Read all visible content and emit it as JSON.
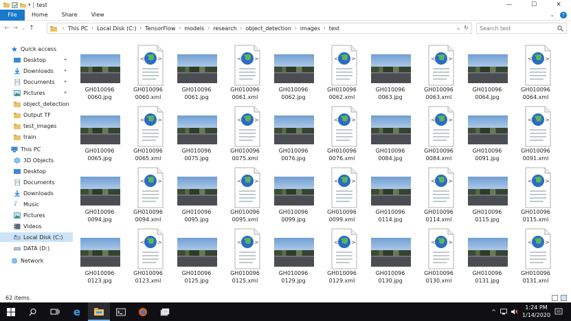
{
  "window": {
    "title": "test",
    "min": "—",
    "max": "☐",
    "close": "✕"
  },
  "ribbon": {
    "file_tab": "File",
    "tabs": [
      "Home",
      "Share",
      "View"
    ],
    "help": "?"
  },
  "address": {
    "crumbs": [
      "This PC",
      "Local Disk (C:)",
      "TensorFlow",
      "models",
      "research",
      "object_detection",
      "images",
      "test"
    ],
    "search_placeholder": "Search test"
  },
  "sidebar": {
    "quick_access": "Quick access",
    "quick_items": [
      {
        "label": "Desktop",
        "pinned": true
      },
      {
        "label": "Downloads",
        "pinned": true
      },
      {
        "label": "Documents",
        "pinned": true
      },
      {
        "label": "Pictures",
        "pinned": true
      },
      {
        "label": "object_detection",
        "pinned": false
      },
      {
        "label": "Output TF",
        "pinned": false
      },
      {
        "label": "test_images",
        "pinned": false
      },
      {
        "label": "train",
        "pinned": false
      }
    ],
    "this_pc": "This PC",
    "pc_items": [
      "3D Objects",
      "Desktop",
      "Documents",
      "Downloads",
      "Music",
      "Pictures",
      "Videos",
      "Local Disk (C:)",
      "DATA (D:)"
    ],
    "network": "Network"
  },
  "files": [
    {
      "line1": "GH010096",
      "line2": "0060.jpg",
      "type": "jpg"
    },
    {
      "line1": "GH010096",
      "line2": "0060.xml",
      "type": "xml"
    },
    {
      "line1": "GH010096",
      "line2": "0061.jpg",
      "type": "jpg"
    },
    {
      "line1": "GH010096",
      "line2": "0061.xml",
      "type": "xml"
    },
    {
      "line1": "GH010096",
      "line2": "0062.jpg",
      "type": "jpg"
    },
    {
      "line1": "GH010096",
      "line2": "0062.xml",
      "type": "xml"
    },
    {
      "line1": "GH010096",
      "line2": "0063.jpg",
      "type": "jpg"
    },
    {
      "line1": "GH010096",
      "line2": "0063.xml",
      "type": "xml"
    },
    {
      "line1": "GH010096",
      "line2": "0064.jpg",
      "type": "jpg"
    },
    {
      "line1": "GH010096",
      "line2": "0064.xml",
      "type": "xml"
    },
    {
      "line1": "GH010096",
      "line2": "0065.jpg",
      "type": "jpg"
    },
    {
      "line1": "GH010096",
      "line2": "0065.xml",
      "type": "xml"
    },
    {
      "line1": "GH010096",
      "line2": "0075.jpg",
      "type": "jpg"
    },
    {
      "line1": "GH010096",
      "line2": "0075.xml",
      "type": "xml"
    },
    {
      "line1": "GH010096",
      "line2": "0076.jpg",
      "type": "jpg"
    },
    {
      "line1": "GH010096",
      "line2": "0076.xml",
      "type": "xml"
    },
    {
      "line1": "GH010096",
      "line2": "0084.jpg",
      "type": "jpg"
    },
    {
      "line1": "GH010096",
      "line2": "0084.xml",
      "type": "xml"
    },
    {
      "line1": "GH010096",
      "line2": "0091.jpg",
      "type": "jpg"
    },
    {
      "line1": "GH010096",
      "line2": "0091.xml",
      "type": "xml"
    },
    {
      "line1": "GH010096",
      "line2": "0094.jpg",
      "type": "jpg"
    },
    {
      "line1": "GH010096",
      "line2": "0094.xml",
      "type": "xml"
    },
    {
      "line1": "GH010096",
      "line2": "0095.jpg",
      "type": "jpg"
    },
    {
      "line1": "GH010096",
      "line2": "0095.xml",
      "type": "xml"
    },
    {
      "line1": "GH010096",
      "line2": "0099.jpg",
      "type": "jpg"
    },
    {
      "line1": "GH010096",
      "line2": "0099.xml",
      "type": "xml"
    },
    {
      "line1": "GH010096",
      "line2": "0114.jpg",
      "type": "jpg"
    },
    {
      "line1": "GH010096",
      "line2": "0114.xml",
      "type": "xml"
    },
    {
      "line1": "GH010096",
      "line2": "0115.jpg",
      "type": "jpg"
    },
    {
      "line1": "GH010096",
      "line2": "0115.xml",
      "type": "xml"
    },
    {
      "line1": "GH010096",
      "line2": "0123.jpg",
      "type": "jpg"
    },
    {
      "line1": "GH010096",
      "line2": "0123.xml",
      "type": "xml"
    },
    {
      "line1": "GH010096",
      "line2": "0125.jpg",
      "type": "jpg"
    },
    {
      "line1": "GH010096",
      "line2": "0125.xml",
      "type": "xml"
    },
    {
      "line1": "GH010096",
      "line2": "0129.jpg",
      "type": "jpg"
    },
    {
      "line1": "GH010096",
      "line2": "0129.xml",
      "type": "xml"
    },
    {
      "line1": "GH010096",
      "line2": "0130.jpg",
      "type": "jpg"
    },
    {
      "line1": "GH010096",
      "line2": "0130.xml",
      "type": "xml"
    },
    {
      "line1": "GH010096",
      "line2": "0131.jpg",
      "type": "jpg"
    },
    {
      "line1": "GH010096",
      "line2": "0131.xml",
      "type": "xml"
    }
  ],
  "status": {
    "count": "62 items"
  },
  "taskbar": {
    "start": "⊞",
    "search": "⚲",
    "apps": [
      "task-view",
      "edge",
      "file-explorer",
      "terminal",
      "firefox",
      "notepad"
    ],
    "tray_arrow": "^",
    "clock_time": "1:24 PM",
    "clock_date": "1/14/2020"
  }
}
